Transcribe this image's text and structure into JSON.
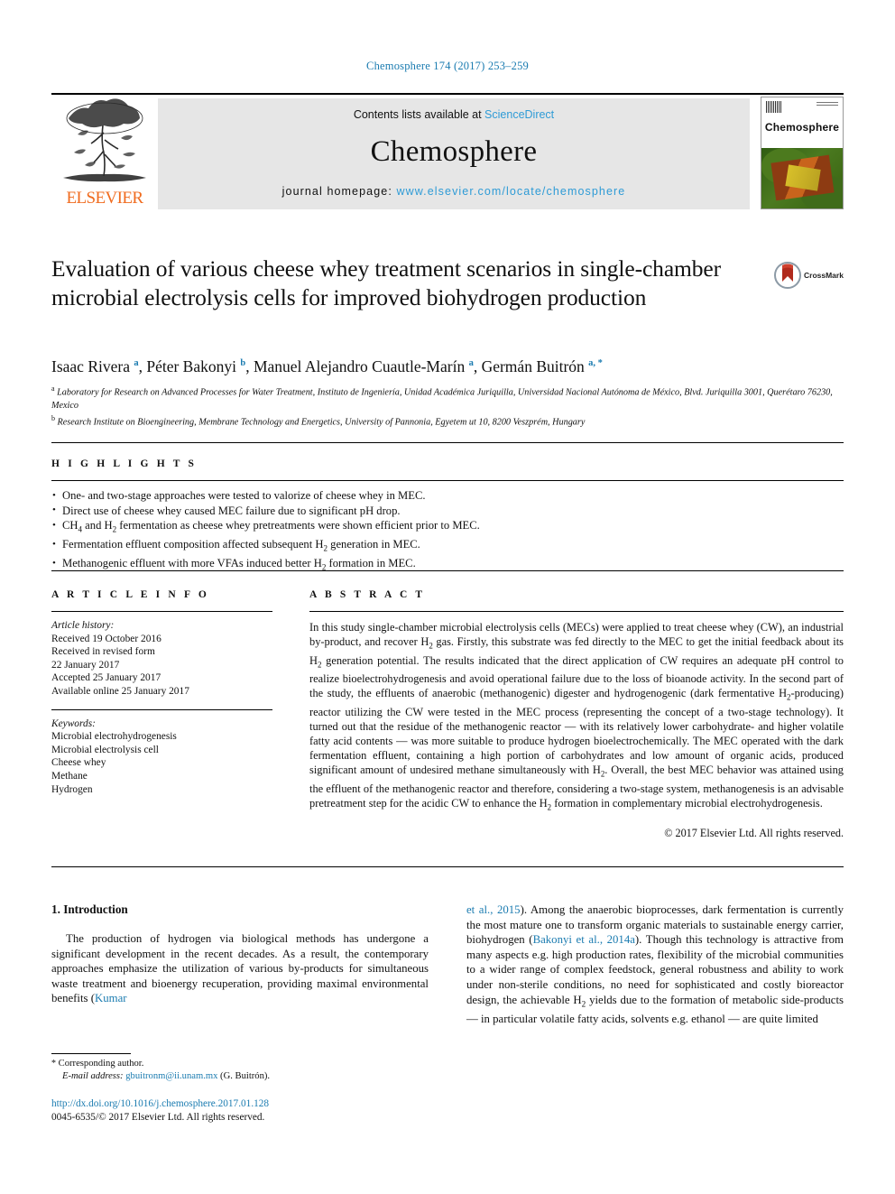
{
  "running_head": "Chemosphere 174 (2017) 253–259",
  "masthead": {
    "publisher_name": "ELSEVIER",
    "contents_prefix": "Contents lists available at ",
    "contents_link": "ScienceDirect",
    "journal_name": "Chemosphere",
    "homepage_prefix": "journal homepage: ",
    "homepage_url": "www.elsevier.com/locate/chemosphere",
    "cover_title": "Chemosphere"
  },
  "article": {
    "title": "Evaluation of various cheese whey treatment scenarios in single-chamber microbial electrolysis cells for improved biohydrogen production",
    "crossmark_label": "CrossMark",
    "authors_html": "Isaac Rivera <sup class=\"aff-mark\">a</sup>, Péter Bakonyi <sup class=\"aff-mark\">b</sup>, Manuel Alejandro Cuautle-Marín <sup class=\"aff-mark\">a</sup>, Germán Buitrón <sup class=\"aff-mark\">a, *</sup>",
    "affiliation_a": "Laboratory for Research on Advanced Processes for Water Treatment, Instituto de Ingeniería, Unidad Académica Juriquilla, Universidad Nacional Autónoma de México, Blvd. Juriquilla 3001, Querétaro 76230, Mexico",
    "affiliation_b": "Research Institute on Bioengineering, Membrane Technology and Energetics, University of Pannonia, Egyetem ut 10, 8200 Veszprém, Hungary"
  },
  "highlights": {
    "heading": "H I G H L I G H T S",
    "items_html": [
      "One- and two-stage approaches were tested to valorize of cheese whey in MEC.",
      "Direct use of cheese whey caused MEC failure due to significant pH drop.",
      "CH<sub>4</sub> and H<sub>2</sub> fermentation as cheese whey pretreatments were shown efficient prior to MEC.",
      "Fermentation effluent composition affected subsequent H<sub>2</sub> generation in MEC.",
      "Methanogenic effluent with more VFAs induced better H<sub>2</sub> formation in MEC."
    ]
  },
  "article_info": {
    "heading": "A R T I C L E   I N F O",
    "history_label": "Article history:",
    "history_lines": [
      "Received 19 October 2016",
      "Received in revised form",
      "22 January 2017",
      "Accepted 25 January 2017",
      "Available online 25 January 2017"
    ],
    "keywords_label": "Keywords:",
    "keywords": [
      "Microbial electrohydrogenesis",
      "Microbial electrolysis cell",
      "Cheese whey",
      "Methane",
      "Hydrogen"
    ]
  },
  "abstract": {
    "heading": "A B S T R A C T",
    "text_html": "In this study single-chamber microbial electrolysis cells (MECs) were applied to treat cheese whey (CW), an industrial by-product, and recover H<sub>2</sub> gas. Firstly, this substrate was fed directly to the MEC to get the initial feedback about its H<sub>2</sub> generation potential. The results indicated that the direct application of CW requires an adequate pH control to realize bioelectrohydrogenesis and avoid operational failure due to the loss of bioanode activity. In the second part of the study, the effluents of anaerobic (methanogenic) digester and hydrogenogenic (dark fermentative H<sub>2</sub>-producing) reactor utilizing the CW were tested in the MEC process (representing the concept of a two-stage technology). It turned out that the residue of the methanogenic reactor — with its relatively lower carbohydrate- and higher volatile fatty acid contents — was more suitable to produce hydrogen bioelectrochemically. The MEC operated with the dark fermentation effluent, containing a high portion of carbohydrates and low amount of organic acids, produced significant amount of undesired methane simultaneously with H<sub>2</sub>. Overall, the best MEC behavior was attained using the effluent of the methanogenic reactor and therefore, considering a two-stage system, methanogenesis is an advisable pretreatment step for the acidic CW to enhance the H<sub>2</sub> formation in complementary microbial electrohydrogenesis.",
    "copyright": "© 2017 Elsevier Ltd. All rights reserved."
  },
  "introduction": {
    "heading": "1. Introduction",
    "left_paragraph_html": "The production of hydrogen via biological methods has undergone a significant development in the recent decades. As a result, the contemporary approaches emphasize the utilization of various by-products for simultaneous waste treatment and bioenergy recuperation, providing maximal environmental benefits (<span class=\"cite\">Kumar</span>",
    "right_paragraph_html": "<span class=\"cite\">et al., 2015</span>). Among the anaerobic bioprocesses, dark fermentation is currently the most mature one to transform organic materials to sustainable energy carrier, biohydrogen (<span class=\"cite\">Bakonyi et al., 2014a</span>). Though this technology is attractive from many aspects e.g. high production rates, flexibility of the microbial communities to a wider range of complex feedstock, general robustness and ability to work under non-sterile conditions, no need for sophisticated and costly bioreactor design, the achievable H<sub>2</sub> yields due to the formation of metabolic side-products — in particular volatile fatty acids, solvents e.g. ethanol — are quite limited"
  },
  "footnotes": {
    "corresponding_author": "Corresponding author.",
    "email_label": "E-mail address:",
    "email": "gbuitronm@ii.unam.mx",
    "email_suffix": "(G. Buitrón).",
    "doi_url": "http://dx.doi.org/10.1016/j.chemosphere.2017.01.128",
    "issn_line": "0045-6535/© 2017 Elsevier Ltd. All rights reserved."
  },
  "colors": {
    "link": "#1a7bb0",
    "sciencedirect": "#2e9bd6",
    "elsevier_orange": "#f06b1e"
  }
}
